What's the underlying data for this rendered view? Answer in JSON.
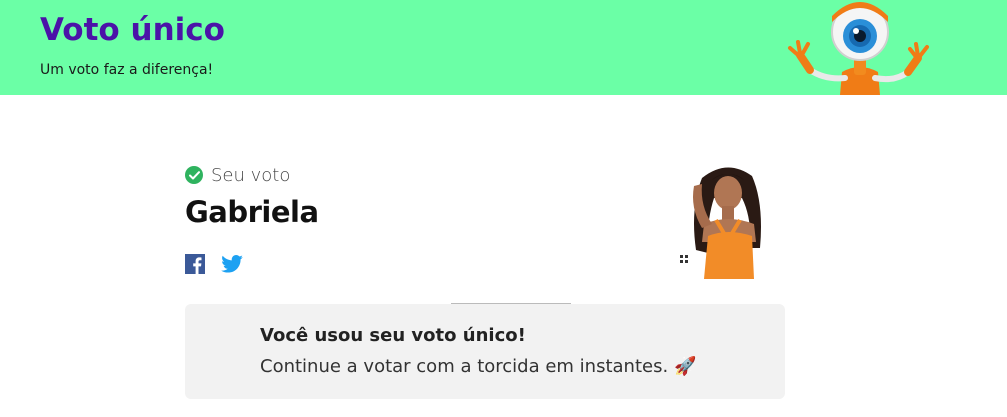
{
  "banner": {
    "title": "Voto único",
    "subtitle": "Um voto faz a diferença!",
    "mascot_icon": "big-brother-eye-mascot"
  },
  "vote": {
    "status_label": "Seu voto",
    "status_icon": "check-circle-icon",
    "candidate_name": "Gabriela",
    "photo_alt": "Gabriela"
  },
  "share": {
    "facebook_icon": "facebook-icon",
    "twitter_icon": "twitter-icon"
  },
  "message": {
    "title": "Você usou seu voto único!",
    "body": "Continue a votar com a torcida em instantes.",
    "emoji": "🚀"
  },
  "colors": {
    "banner_bg": "#6bffa6",
    "title_purple": "#4b13a8",
    "check_green": "#2fb35f",
    "facebook_blue": "#3b5998",
    "twitter_blue": "#1da1f2",
    "message_bg": "#f2f2f2"
  }
}
